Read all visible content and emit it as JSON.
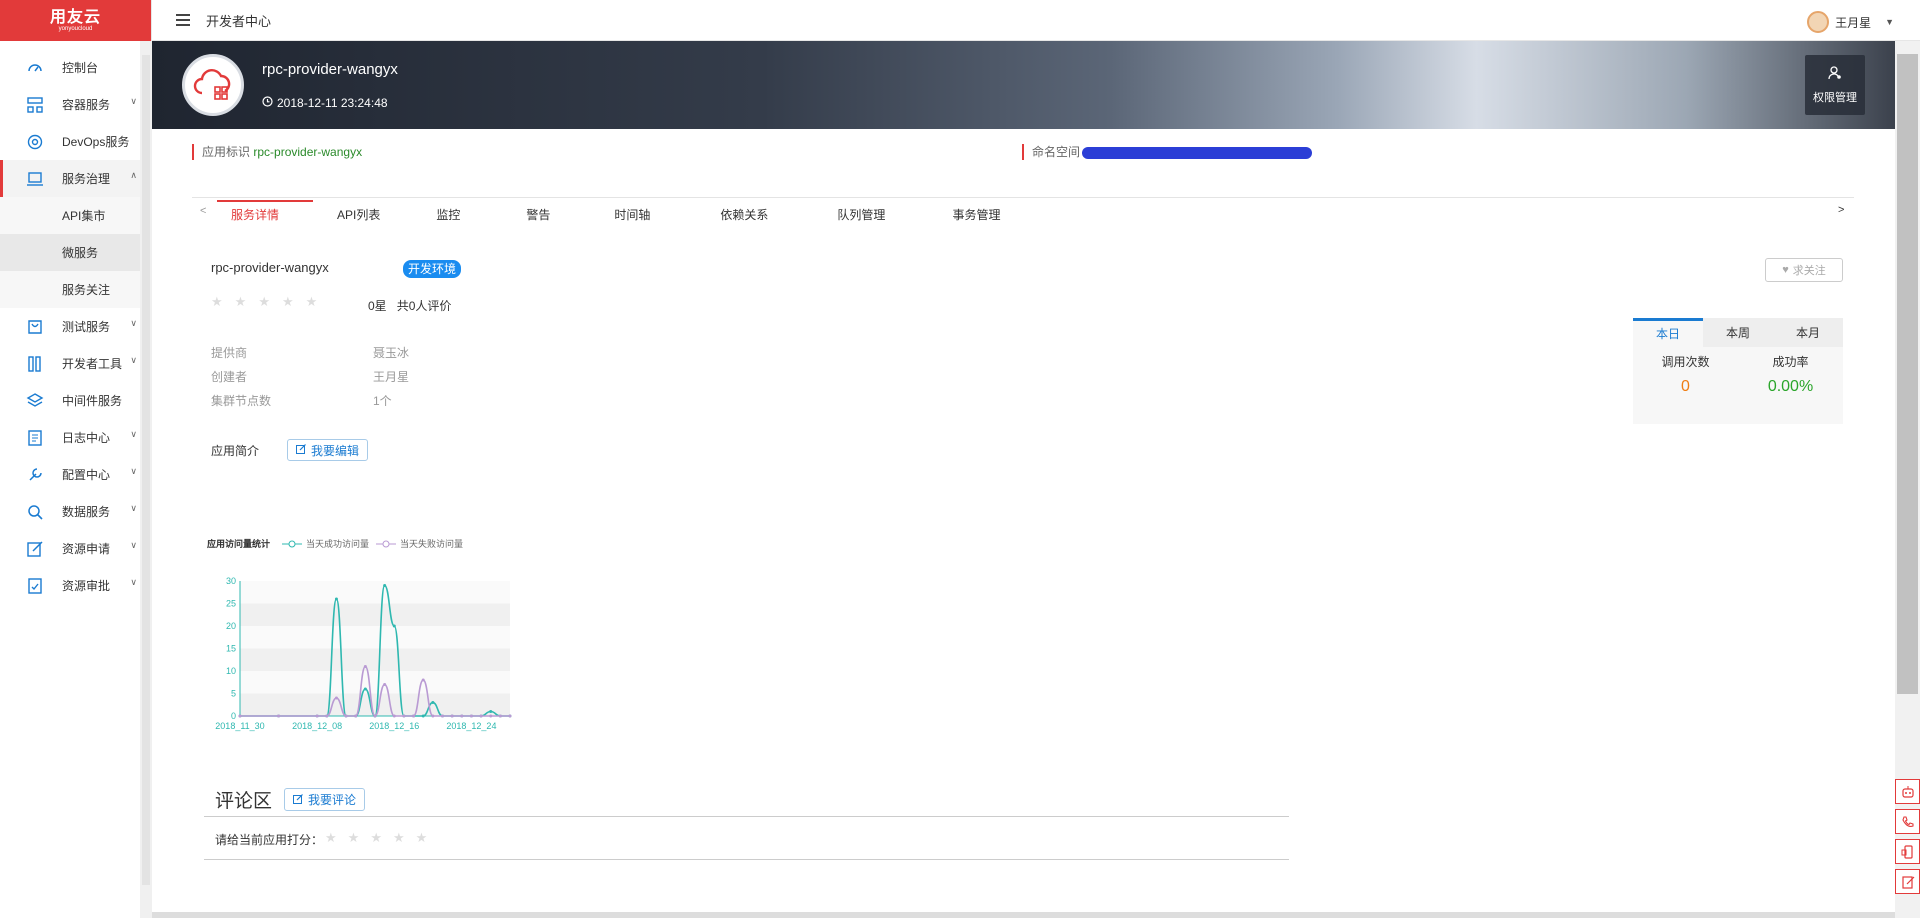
{
  "brand": {
    "name": "用友云",
    "sub": "yonyoucloud"
  },
  "topbar": {
    "title": "开发者中心",
    "user": "王月星"
  },
  "sidebar": {
    "items": [
      {
        "label": "控制台",
        "icon": "dashboard-icon"
      },
      {
        "label": "容器服务",
        "icon": "container-icon"
      },
      {
        "label": "DevOps服务",
        "icon": "devops-icon"
      },
      {
        "label": "服务治理",
        "icon": "laptop-icon"
      },
      {
        "label": "测试服务",
        "icon": "test-icon"
      },
      {
        "label": "开发者工具",
        "icon": "tools-icon"
      },
      {
        "label": "中间件服务",
        "icon": "layers-icon"
      },
      {
        "label": "日志中心",
        "icon": "log-icon"
      },
      {
        "label": "配置中心",
        "icon": "wrench-icon"
      },
      {
        "label": "数据服务",
        "icon": "search-data-icon"
      },
      {
        "label": "资源申请",
        "icon": "edit-icon"
      },
      {
        "label": "资源审批",
        "icon": "approve-icon"
      }
    ],
    "sub": [
      "API集市",
      "微服务",
      "服务关注"
    ]
  },
  "banner": {
    "name": "rpc-provider-wangyx",
    "time": "2018-12-11 23:24:48",
    "perm": "权限管理"
  },
  "info": {
    "app_id_label": "应用标识",
    "app_id": "rpc-provider-wangyx",
    "ns_label": "命名空间"
  },
  "tabs": [
    "服务详情",
    "API列表",
    "监控",
    "警告",
    "时间轴",
    "依赖关系",
    "队列管理",
    "事务管理"
  ],
  "detail": {
    "name": "rpc-provider-wangyx",
    "env": "开发环境",
    "rating": "0星",
    "reviews": "共0人评价",
    "follow": "求关注",
    "provider_label": "提供商",
    "provider": "聂玉冰",
    "creator_label": "创建者",
    "creator": "王月星",
    "nodes_label": "集群节点数",
    "nodes": "1个",
    "intro_label": "应用简介",
    "edit_btn": "我要编辑"
  },
  "stats": {
    "tabs": [
      "本日",
      "本周",
      "本月"
    ],
    "calls_label": "调用次数",
    "rate_label": "成功率",
    "calls": "0",
    "rate": "0.00%",
    "calls_color": "#ef7d12",
    "rate_color": "#2aa52a"
  },
  "chart_title": "应用访问量统计",
  "chart_data": {
    "type": "line",
    "title": "应用访问量统计",
    "x_ticks": [
      "2018_11_30",
      "2018_12_08",
      "2018_12_16",
      "2018_12_24"
    ],
    "y_ticks": [
      0,
      5,
      10,
      15,
      20,
      25,
      30
    ],
    "ylim": [
      0,
      30
    ],
    "x": [
      "2018-11-30",
      "2018-12-04",
      "2018-12-08",
      "2018-12-09",
      "2018-12-10",
      "2018-12-11",
      "2018-12-12",
      "2018-12-13",
      "2018-12-14",
      "2018-12-15",
      "2018-12-16",
      "2018-12-17",
      "2018-12-18",
      "2018-12-19",
      "2018-12-20",
      "2018-12-21",
      "2018-12-22",
      "2018-12-23",
      "2018-12-24",
      "2018-12-25",
      "2018-12-26",
      "2018-12-27",
      "2018-12-28"
    ],
    "series": [
      {
        "name": "当天成功访问量",
        "color": "#2fb8b0",
        "values": [
          0,
          0,
          0,
          0,
          26,
          0,
          0,
          6,
          0,
          29,
          20,
          0,
          0,
          0,
          3,
          0,
          0,
          0,
          0,
          0,
          1,
          0,
          0
        ]
      },
      {
        "name": "当天失败访问量",
        "color": "#b99ad3",
        "values": [
          0,
          0,
          0,
          0,
          4,
          0,
          0,
          11,
          0,
          7,
          0,
          0,
          0,
          8,
          0,
          0,
          0,
          0,
          0,
          0,
          0,
          0,
          0
        ]
      }
    ]
  },
  "comments": {
    "title": "评论区",
    "btn": "我要评论",
    "rate_label": "请给当前应用打分："
  }
}
